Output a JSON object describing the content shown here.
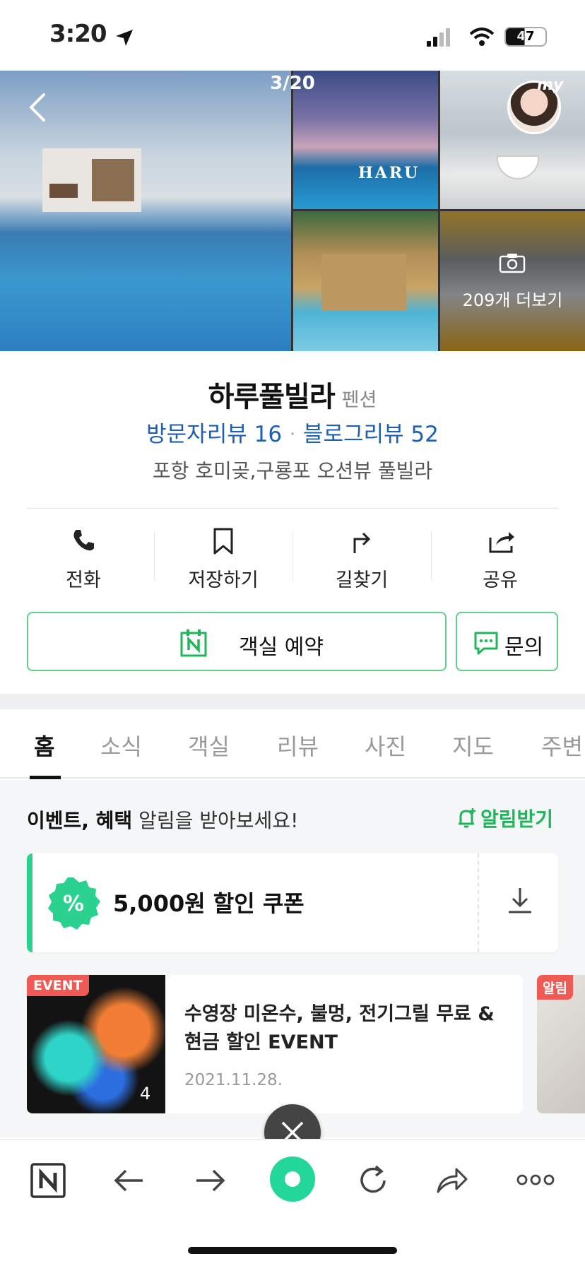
{
  "status_bar": {
    "time": "3:20",
    "battery": "47"
  },
  "gallery": {
    "counter": "3/20",
    "more_photos_label": "209개 더보기",
    "avatar_label": "my",
    "photo_caption": "HARU"
  },
  "place": {
    "name": "하루풀빌라",
    "category": "펜션",
    "visitor_reviews_label": "방문자리뷰 16",
    "blog_reviews_label": "블로그리뷰 52",
    "description": "포항 호미곶,구룡포 오션뷰 풀빌라"
  },
  "actions": [
    {
      "label": "전화",
      "icon": "phone-icon"
    },
    {
      "label": "저장하기",
      "icon": "bookmark-icon"
    },
    {
      "label": "길찾기",
      "icon": "directions-icon"
    },
    {
      "label": "공유",
      "icon": "share-icon"
    }
  ],
  "buttons": {
    "reserve": "객실 예약",
    "inquiry": "문의"
  },
  "tabs": [
    "홈",
    "소식",
    "객실",
    "리뷰",
    "사진",
    "지도",
    "주변"
  ],
  "active_tab": "홈",
  "alert": {
    "bold": "이벤트, 혜택",
    "rest": " 알림을 받아보세요!",
    "button": "알림받기"
  },
  "coupon": {
    "label": "5,000원 할인 쿠폰"
  },
  "event": {
    "badge": "EVENT",
    "title": "수영장 미온수, 불멍, 전기그릴 무료 & 현금 할인 EVENT",
    "date": "2021.11.28.",
    "image_count": "4"
  },
  "event2": {
    "badge": "알림"
  },
  "colors": {
    "brand_green": "#1fb559",
    "link_blue": "#1f5fb3",
    "badge_red": "#f05a55"
  }
}
